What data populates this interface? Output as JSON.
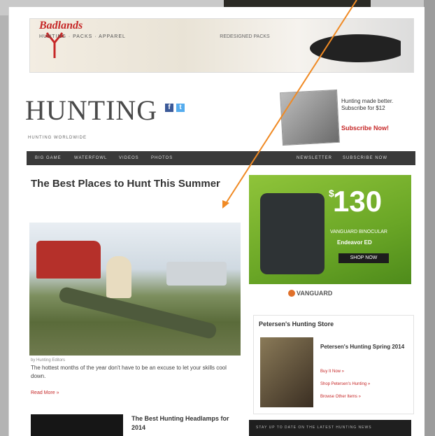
{
  "colors": {
    "accent": "#c62828",
    "nav_bg": "#3a3a3a",
    "ad_green": "#6aa626",
    "arrow": "#f08a24"
  },
  "banner": {
    "brand": "Badlands",
    "brand_sub": "HUNTING · PACKS · APPAREL",
    "promo": "REDESIGNED PACKS"
  },
  "site": {
    "logo": "HUNTING",
    "tagline": "HUNTING WORLDWIDE",
    "subscribe_text": "Hunting made better. Subscribe for $12",
    "subscribe_link": "Subscribe Now!"
  },
  "social": {
    "facebook": "f",
    "twitter": "t"
  },
  "nav": {
    "items": [
      "BIG GAME",
      "WATERFOWL",
      "VIDEOS",
      "PHOTOS"
    ],
    "right_items": [
      "NEWSLETTER",
      "SUBSCRIBE NOW"
    ]
  },
  "article": {
    "headline": "The Best Places to Hunt This Summer",
    "byline": "by Hunting Editors",
    "excerpt": "The hottest months of the year don't have to be an excuse to let your skills cool down.",
    "read_more": "Read More »"
  },
  "related": {
    "title": "The Best Hunting Headlamps for 2014"
  },
  "ad": {
    "price": "130",
    "currency": "$",
    "small": "VANGUARD BINOCULAR",
    "tag": "Endeavor ED",
    "button": "SHOP NOW"
  },
  "sponsor": {
    "name": "VANGUARD"
  },
  "store": {
    "title": "Petersen's Hunting Store",
    "product": "Petersen's Hunting Spring 2014",
    "links": [
      "Buy It Now »",
      "Shop Petersen's Hunting »",
      "Browse Other Items »"
    ]
  },
  "bottom_ad": {
    "text": "STAY UP TO DATE ON THE LATEST HUNTING NEWS"
  }
}
